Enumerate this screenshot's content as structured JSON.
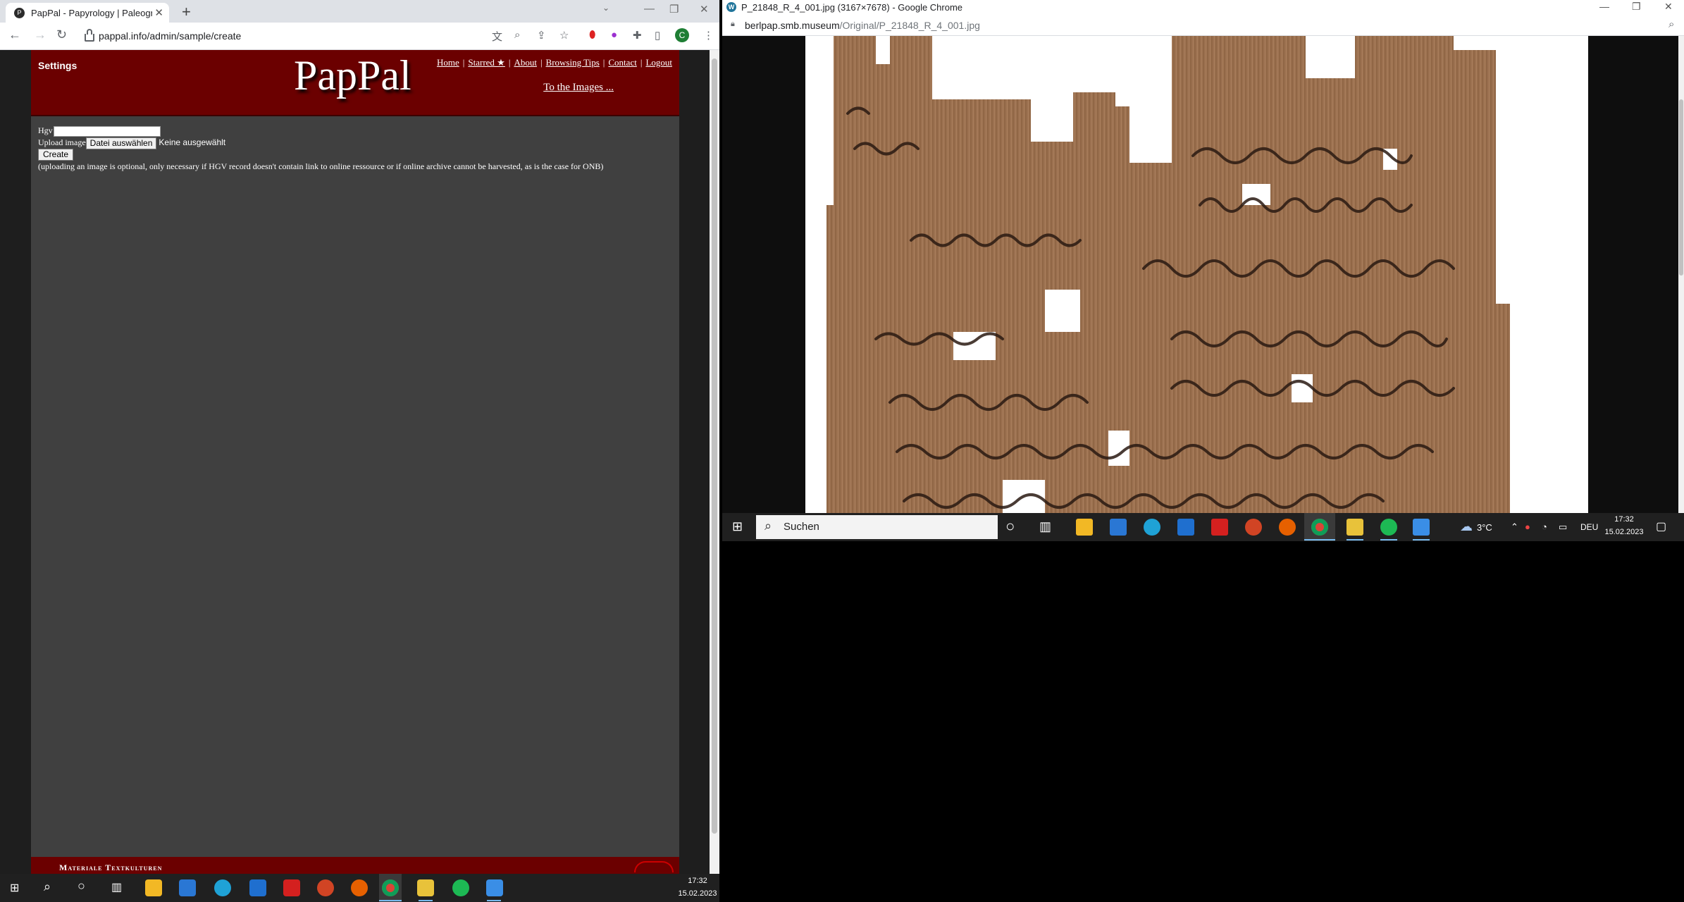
{
  "left_browser": {
    "tab_title": "PapPal - Papyrology | Paleograph",
    "favicon": "pappal-icon",
    "new_tab": "+",
    "url": "pappal.info/admin/sample/create",
    "profile_initial": "C"
  },
  "site": {
    "settings": "Settings",
    "logo": "PapPal",
    "nav": [
      "Home",
      "Starred ★",
      "About",
      "Browsing Tips",
      "Contact",
      "Logout"
    ],
    "nav_separator": "|",
    "to_images": "To the Images ...",
    "form": {
      "hgv_label": "Hgv",
      "upload_label": "Upload image",
      "file_button": "Datei auswählen",
      "no_file": "Keine ausgewählt",
      "create_button": "Create",
      "note": "(uploading an image is optional, only necessary if HGV record doesn't contain link to online ressource or if online archive cannot be harvested, as is the case for ONB)"
    },
    "footer_text": "Materiale Textkulturen"
  },
  "left_taskbar": {
    "time": "17:32",
    "date": "15.02.2023"
  },
  "right_browser": {
    "window_title": "P_21848_R_4_001.jpg (3167×7678) - Google Chrome",
    "url_host": "berlpap.smb.museum",
    "url_path": "/Original/P_21848_R_4_001.jpg",
    "image_description": "papyrus-image"
  },
  "right_taskbar": {
    "search_placeholder": "Suchen",
    "weather": "3°C",
    "language": "DEU",
    "time": "17:32",
    "date": "15.02.2023"
  },
  "colors": {
    "site_header": "#6b0000",
    "site_body": "#404040",
    "taskbar": "#202020",
    "papyrus": "#9c7150"
  }
}
